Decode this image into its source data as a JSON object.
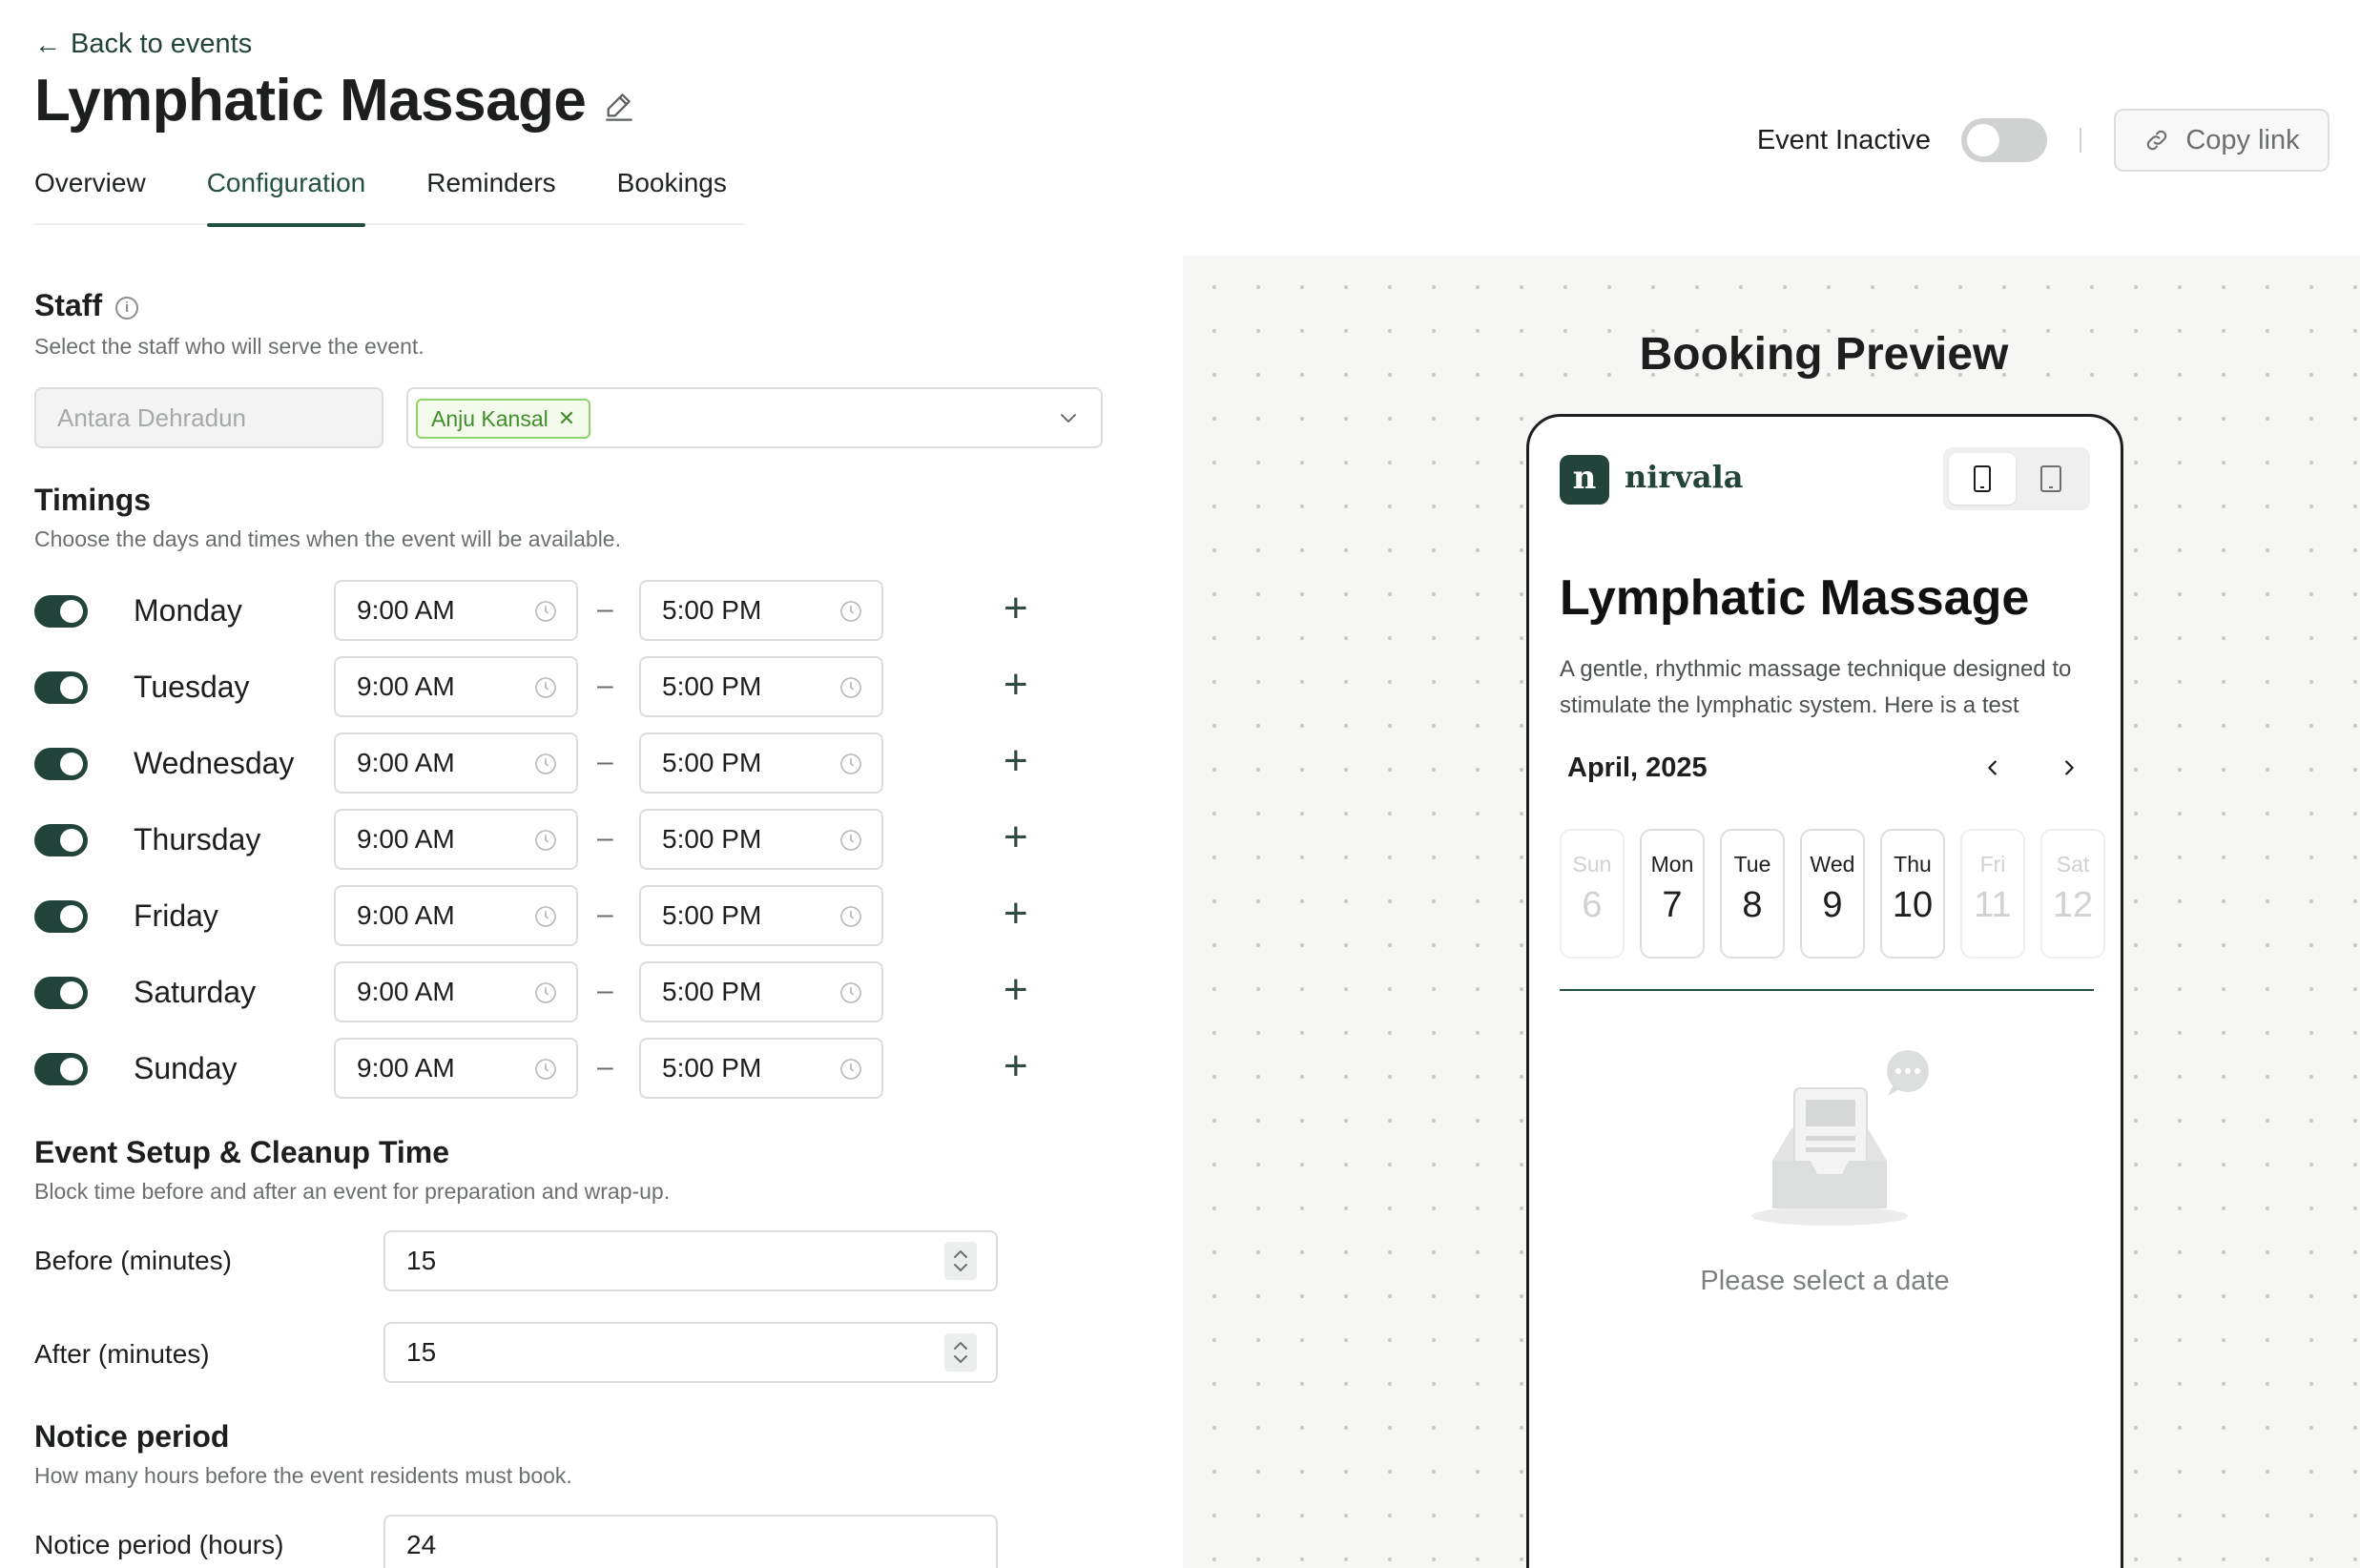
{
  "nav": {
    "back_label": "Back to events"
  },
  "event": {
    "title": "Lymphatic Massage"
  },
  "tabs": [
    {
      "label": "Overview",
      "active": false
    },
    {
      "label": "Configuration",
      "active": true
    },
    {
      "label": "Reminders",
      "active": false
    },
    {
      "label": "Bookings",
      "active": false
    }
  ],
  "header_actions": {
    "status_label": "Event Inactive",
    "active": false,
    "copy_label": "Copy link"
  },
  "staff": {
    "title": "Staff",
    "description": "Select the staff who will serve the event.",
    "location_placeholder": "Antara Dehradun",
    "selected": [
      "Anju Kansal"
    ]
  },
  "timings": {
    "title": "Timings",
    "description": "Choose the days and times when the event will be available.",
    "days": [
      {
        "day": "Monday",
        "enabled": true,
        "start": "9:00 AM",
        "end": "5:00 PM"
      },
      {
        "day": "Tuesday",
        "enabled": true,
        "start": "9:00 AM",
        "end": "5:00 PM"
      },
      {
        "day": "Wednesday",
        "enabled": true,
        "start": "9:00 AM",
        "end": "5:00 PM"
      },
      {
        "day": "Thursday",
        "enabled": true,
        "start": "9:00 AM",
        "end": "5:00 PM"
      },
      {
        "day": "Friday",
        "enabled": true,
        "start": "9:00 AM",
        "end": "5:00 PM"
      },
      {
        "day": "Saturday",
        "enabled": true,
        "start": "9:00 AM",
        "end": "5:00 PM"
      },
      {
        "day": "Sunday",
        "enabled": true,
        "start": "9:00 AM",
        "end": "5:00 PM"
      }
    ],
    "dash": "–",
    "add_glyph": "+"
  },
  "setup": {
    "title": "Event Setup & Cleanup Time",
    "description": "Block time before and after an event for preparation and wrap-up.",
    "before_label": "Before (minutes)",
    "before_value": "15",
    "after_label": "After (minutes)",
    "after_value": "15"
  },
  "notice": {
    "title": "Notice period",
    "description": "How many hours before the event residents must book.",
    "label": "Notice period (hours)",
    "value": "24"
  },
  "preview": {
    "heading": "Booking Preview",
    "brand_letter": "n",
    "brand_name": "nirvala",
    "event_title": "Lymphatic Massage",
    "event_description": "A gentle, rhythmic massage technique designed to stimulate the lymphatic system. Here is a test",
    "month": "April, 2025",
    "days": [
      {
        "name": "Sun",
        "date": "6",
        "available": false
      },
      {
        "name": "Mon",
        "date": "7",
        "available": true
      },
      {
        "name": "Tue",
        "date": "8",
        "available": true
      },
      {
        "name": "Wed",
        "date": "9",
        "available": true
      },
      {
        "name": "Thu",
        "date": "10",
        "available": true
      },
      {
        "name": "Fri",
        "date": "11",
        "available": false
      },
      {
        "name": "Sat",
        "date": "12",
        "available": false
      }
    ],
    "empty_message": "Please select a date"
  },
  "colors": {
    "brand": "#23443a",
    "tag_bg": "#f4fbec",
    "tag_border": "#8fd16a",
    "tag_text": "#3f8e2a"
  }
}
